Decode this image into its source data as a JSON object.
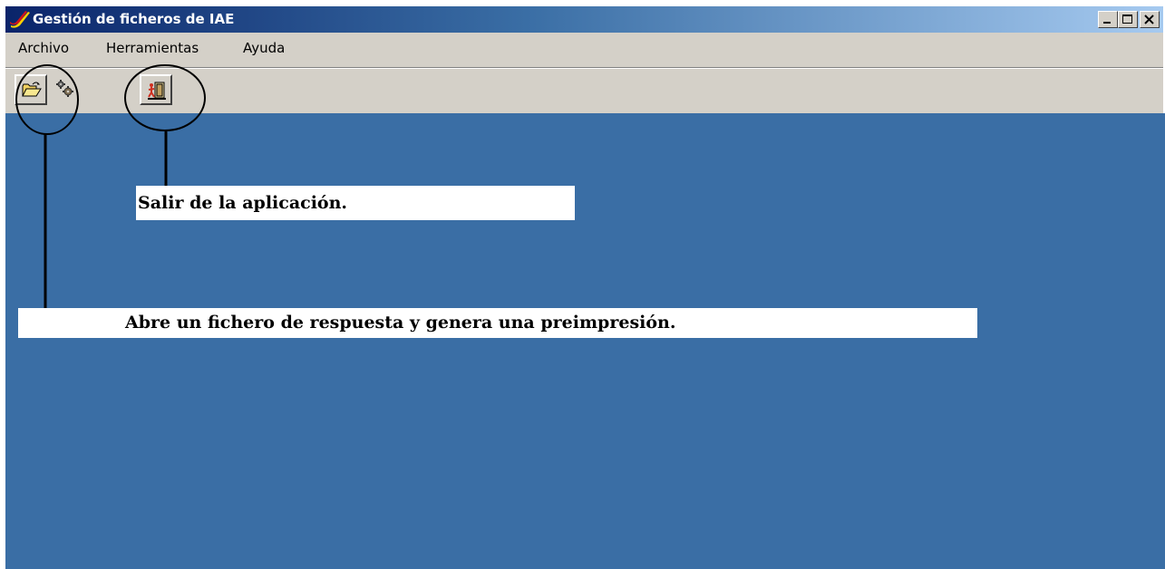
{
  "window": {
    "title": "Gestión de  ficheros de IAE",
    "controls": [
      "minimize-icon",
      "maximize-icon",
      "close-icon"
    ]
  },
  "menu": {
    "items": [
      {
        "label": "Archivo"
      },
      {
        "label": "Herramientas"
      },
      {
        "label": "Ayuda"
      }
    ]
  },
  "toolbar": {
    "buttons": [
      {
        "icon": "open-folder-icon"
      },
      {
        "icon": "gears-icon"
      },
      {
        "icon": "exit-door-icon"
      }
    ]
  },
  "annotations": {
    "exit_note": "Salir de la aplicación.",
    "open_note": "Abre un fichero de respuesta y genera una preimpresión."
  },
  "colors": {
    "titlebar_start": "#0a246a",
    "titlebar_end": "#a6caf0",
    "client_background": "#3a6ea5",
    "chrome": "#d4d0c8"
  }
}
